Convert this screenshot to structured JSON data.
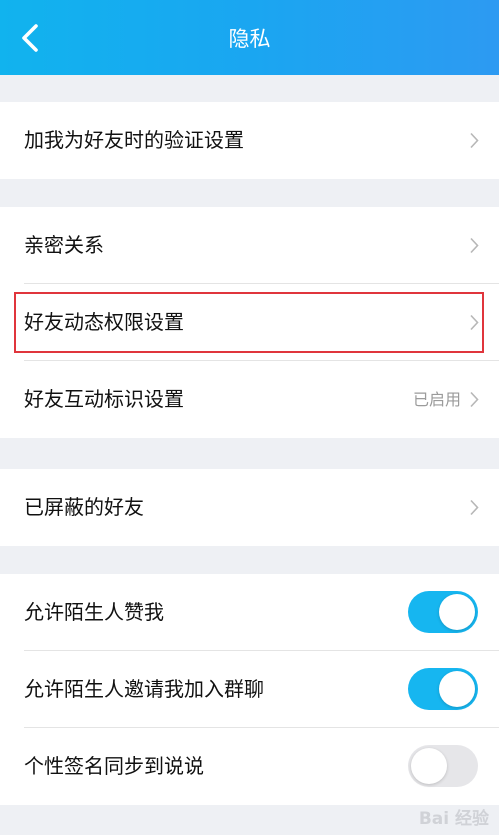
{
  "header": {
    "title": "隐私",
    "back_icon": "chevron-left-icon"
  },
  "colors": {
    "header_gradient_start": "#11b3ee",
    "header_gradient_end": "#2d9af2",
    "toggle_on": "#16b6f0",
    "toggle_off": "#e6e6e9",
    "highlight_border": "#e0353c",
    "background": "#eef0f4"
  },
  "groups": [
    {
      "items": [
        {
          "label": "加我为好友时的验证设置",
          "type": "link"
        }
      ]
    },
    {
      "items": [
        {
          "label": "亲密关系",
          "type": "link"
        },
        {
          "label": "好友动态权限设置",
          "type": "link",
          "highlighted": true
        },
        {
          "label": "好友互动标识设置",
          "type": "link",
          "value": "已启用"
        }
      ]
    },
    {
      "items": [
        {
          "label": "已屏蔽的好友",
          "type": "link"
        }
      ]
    },
    {
      "items": [
        {
          "label": "允许陌生人赞我",
          "type": "toggle",
          "on": true
        },
        {
          "label": "允许陌生人邀请我加入群聊",
          "type": "toggle",
          "on": true
        },
        {
          "label": "个性签名同步到说说",
          "type": "toggle",
          "on": false
        }
      ]
    }
  ],
  "watermark": {
    "text": "Bai 经验"
  }
}
